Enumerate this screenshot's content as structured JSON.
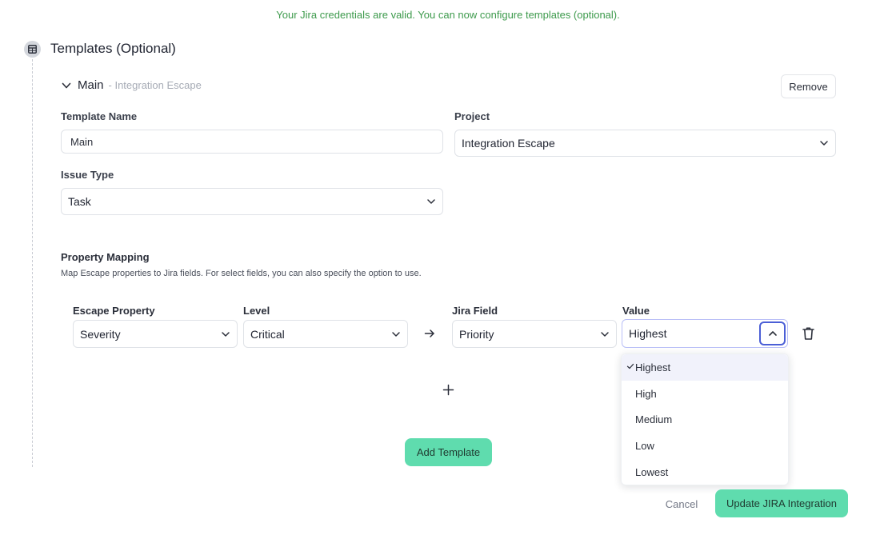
{
  "banner": {
    "message": "Your Jira credentials are valid. You can now configure templates (optional)."
  },
  "section": {
    "title": "Templates (Optional)",
    "icon": "table-icon"
  },
  "template": {
    "name": "Main",
    "project_suffix": "- Integration Escape",
    "remove_label": "Remove",
    "fields": {
      "template_name_label": "Template Name",
      "template_name_value": "Main",
      "project_label": "Project",
      "project_value": "Integration Escape",
      "issue_type_label": "Issue Type",
      "issue_type_value": "Task"
    }
  },
  "property_mapping": {
    "title": "Property Mapping",
    "description": "Map Escape properties to Jira fields. For select fields, you can also specify the option to use.",
    "columns": {
      "escape_property": "Escape Property",
      "level": "Level",
      "jira_field": "Jira Field",
      "value": "Value"
    },
    "row": {
      "escape_property": "Severity",
      "level": "Critical",
      "jira_field": "Priority",
      "value": "Highest"
    },
    "value_options": [
      "Highest",
      "High",
      "Medium",
      "Low",
      "Lowest"
    ],
    "selected_option": "Highest"
  },
  "actions": {
    "add_template": "Add Template",
    "cancel": "Cancel",
    "update": "Update JIRA Integration"
  },
  "colors": {
    "success_text": "#3d9a4c",
    "primary_button": "#5fdcae",
    "focus_ring": "#4b5fd6"
  }
}
